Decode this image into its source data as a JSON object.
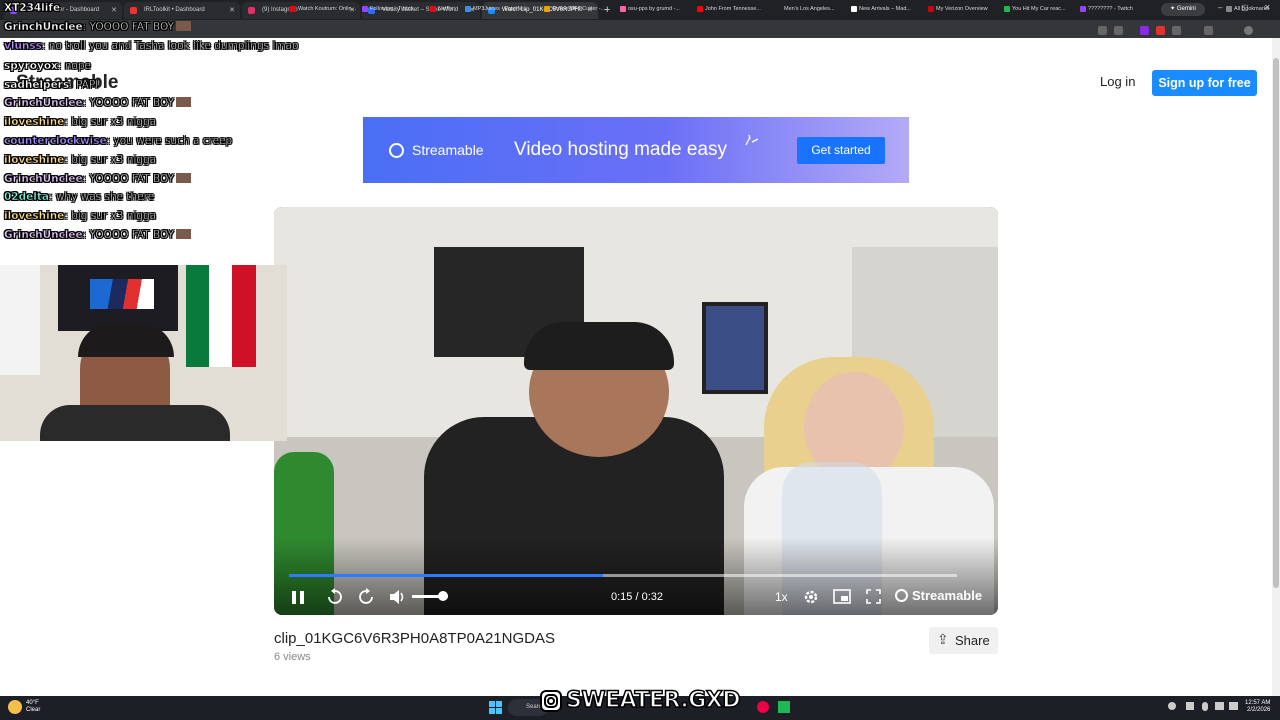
{
  "browser": {
    "tabs": [
      {
        "label": "TTV XT234lifer - Dashboard",
        "active": false
      },
      {
        "label": "IRLToolkit • Dashboard",
        "active": false
      },
      {
        "label": "(9) Instagram",
        "active": false
      },
      {
        "label": "Varsity Jacket – Stake World",
        "active": false
      },
      {
        "label": "Watch clip_01KGC6V6R3PH0",
        "active": true
      }
    ],
    "new_tab": "+",
    "gemini_label": "✦ Gemini",
    "window_controls": [
      "–",
      "▢",
      "✕"
    ],
    "bookmarks": [
      "Watch Koutrum: Onlin...",
      "Following - Twitch",
      "Netflix",
      "MP3Juices - Free M...",
      "Online MP3 Cutter -...",
      "osu-pps by grumd -...",
      "John From Tennesse...",
      "Men's Los Angeles...",
      "New Arrivals – Mad...",
      "My Verizon Overview",
      "You Hit My Car reac...",
      "???????? - Twitch"
    ],
    "all_bookmarks": "All Bookmarks"
  },
  "header": {
    "logo": "Streamable",
    "login": "Log in",
    "signup": "Sign up for free"
  },
  "banner": {
    "brand": "Streamable",
    "title": "Video hosting made easy",
    "cta": "Get started"
  },
  "player": {
    "time": "0:15 / 0:32",
    "progress": 0.47,
    "volume": 0.85,
    "speed": "1x",
    "watermark": "Streamable"
  },
  "clip": {
    "title": "clip_01KGC6V6R3PH0A8TP0A21NGDAS",
    "views": "6 views",
    "share": "Share"
  },
  "overlay": {
    "channel": "XT234life",
    "chat": [
      {
        "user": "GrinchUnclee",
        "text": "YOOOO FAT BOY",
        "emote": true,
        "color": "#ffffff"
      },
      {
        "user": "vlunss",
        "text": "no troll you and Tasha look like dumplings lmao",
        "emote": false,
        "color": "#b98cff"
      },
      {
        "user": "spyroyox",
        "text": "nope",
        "emote": false,
        "color": "#ffffff"
      },
      {
        "user": "sadhelpers",
        "text": "PAPI",
        "emote": false,
        "color": "#ffffff"
      },
      {
        "user": "GrinchUnclee",
        "text": "YOOOO FAT BOY",
        "emote": true,
        "color": "#e7c8ff"
      },
      {
        "user": "iloveshine",
        "text": "big sur x3 nigga",
        "emote": false,
        "color": "#ffe08a"
      },
      {
        "user": "counterclockwise",
        "text": "you were such a creep",
        "emote": false,
        "color": "#a58cff"
      },
      {
        "user": "iloveshine",
        "text": "big sur x3 nigga",
        "emote": false,
        "color": "#ffe08a"
      },
      {
        "user": "GrinchUnclee",
        "text": "YOOOO FAT BOY",
        "emote": true,
        "color": "#e7c8ff"
      },
      {
        "user": "02delta",
        "text": "why was she there",
        "emote": false,
        "color": "#7ef0d8"
      },
      {
        "user": "iloveshine",
        "text": "big sur x3 nigga",
        "emote": false,
        "color": "#ffe08a"
      },
      {
        "user": "GrinchUnclee",
        "text": "YOOOO FAT BOY",
        "emote": true,
        "color": "#e7c8ff"
      }
    ],
    "handle": "SWEATER.GXD"
  },
  "taskbar": {
    "weather_temp": "40°F",
    "weather_desc": "Clear",
    "search": "Search",
    "time": "12:57 AM",
    "date": "2/2/2026"
  },
  "colors": {
    "accent": "#1a8cff",
    "progress": "#2f7bff"
  }
}
